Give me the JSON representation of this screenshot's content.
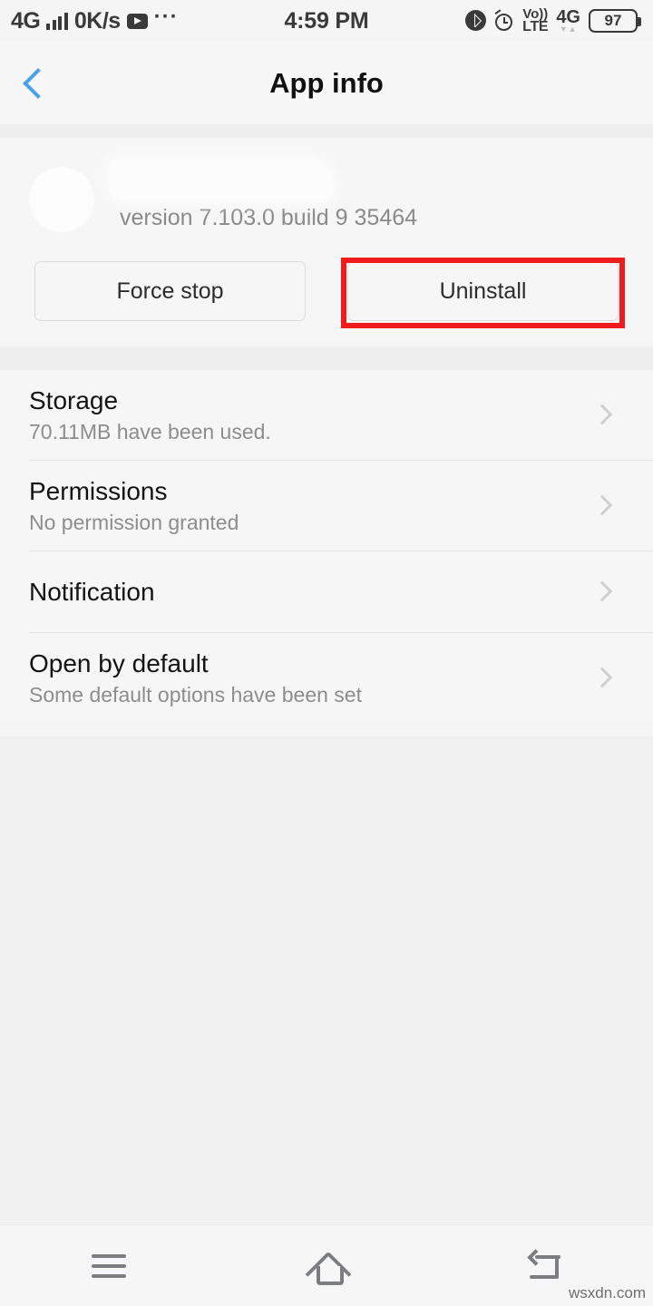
{
  "status_bar": {
    "network_type": "4G",
    "data_speed": "0K/s",
    "play_icon": "play-icon",
    "more_icon": "overflow-dots-icon",
    "clock": "4:59 PM",
    "bluetooth_icon": "bluetooth-icon",
    "alarm_icon": "alarm-clock-icon",
    "volte_line1": "Vo))",
    "volte_line2": "LTE",
    "network_right": "4G",
    "data_arrows": "▼▲",
    "battery_level": "97"
  },
  "header": {
    "back_icon": "back-chevron-icon",
    "title": "App info",
    "accent_color": "#4aa3e8"
  },
  "app": {
    "icon": "app-icon-redacted",
    "name": "",
    "version": "version 7.103.0 build 9 35464"
  },
  "actions": {
    "force_stop_label": "Force stop",
    "uninstall_label": "Uninstall",
    "highlight_color": "#ee1c1c",
    "highlighted": "uninstall-button"
  },
  "settings_list": [
    {
      "title": "Storage",
      "subtitle": "70.11MB have been used.",
      "chevron": "chevron-right-icon"
    },
    {
      "title": "Permissions",
      "subtitle": "No permission granted",
      "chevron": "chevron-right-icon"
    },
    {
      "title": "Notification",
      "subtitle": "",
      "chevron": "chevron-right-icon"
    },
    {
      "title": "Open by default",
      "subtitle": "Some default options have been set",
      "chevron": "chevron-right-icon"
    }
  ],
  "nav_bar": {
    "menu_icon": "menu-icon",
    "home_icon": "home-icon",
    "back_icon": "back-icon"
  },
  "watermark": "wsxdn.com"
}
